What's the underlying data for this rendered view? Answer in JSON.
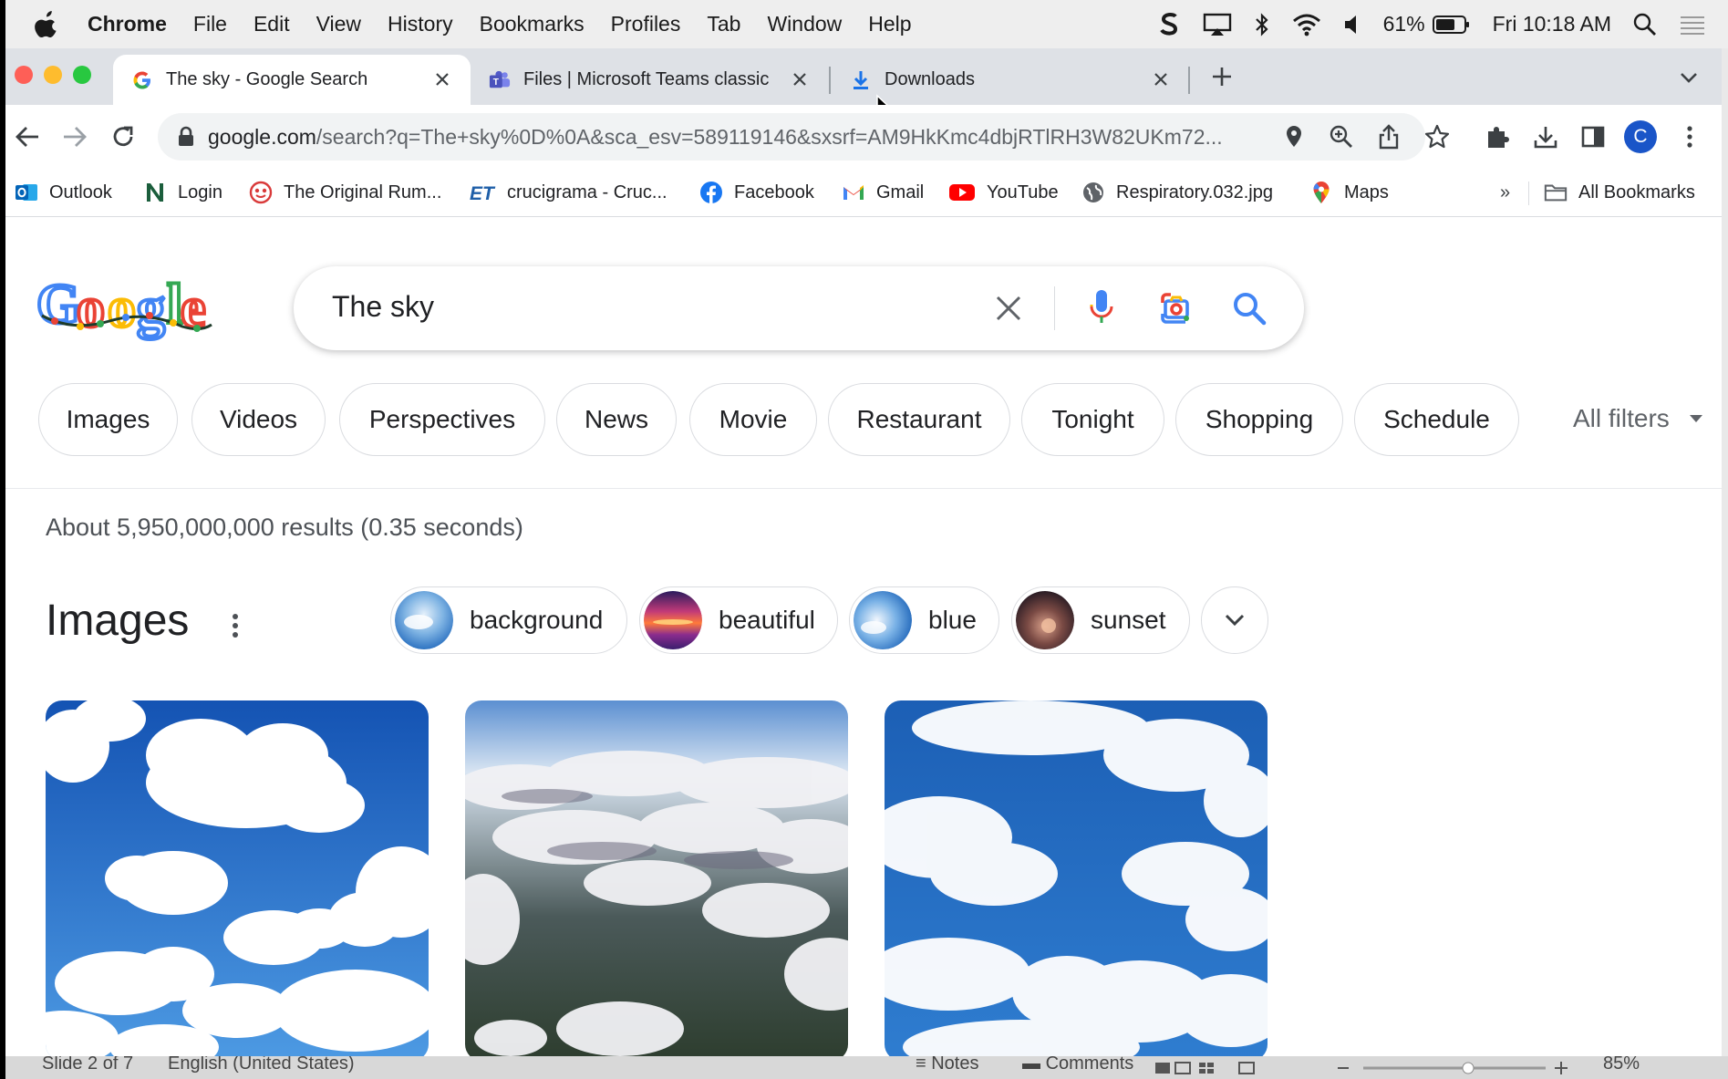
{
  "menubar": {
    "items": [
      "Chrome",
      "File",
      "Edit",
      "View",
      "History",
      "Bookmarks",
      "Profiles",
      "Tab",
      "Window",
      "Help"
    ],
    "battery": "61%",
    "clock": "Fri 10:18 AM"
  },
  "tabs": [
    {
      "title": "The sky - Google Search",
      "favicon": "google-g-icon"
    },
    {
      "title": "Files | Microsoft Teams classic",
      "favicon": "teams-icon"
    },
    {
      "title": "Downloads",
      "favicon": "download-icon"
    }
  ],
  "address": {
    "host": "google.com",
    "path": "/search?q=The+sky%0D%0A&sca_esv=589119146&sxsrf=AM9HkKmc4dbjRTlRH3W82UKm72..."
  },
  "bookmarks": [
    {
      "label": "Outlook"
    },
    {
      "label": "Login"
    },
    {
      "label": "The Original Rum..."
    },
    {
      "label": "crucigrama - Cruc..."
    },
    {
      "label": "Facebook"
    },
    {
      "label": "Gmail"
    },
    {
      "label": "YouTube"
    },
    {
      "label": "Respiratory.032.jpg"
    },
    {
      "label": "Maps"
    }
  ],
  "bookmarks_more": "»",
  "all_bookmarks": "All Bookmarks",
  "search": {
    "query": "The sky",
    "stats": "About 5,950,000,000 results (0.35 seconds)"
  },
  "chips": [
    "Images",
    "Videos",
    "Perspectives",
    "News",
    "Movie",
    "Restaurant",
    "Tonight",
    "Shopping",
    "Schedule"
  ],
  "all_filters": "All filters",
  "images_section": {
    "title": "Images",
    "refinements": [
      "background",
      "beautiful",
      "blue",
      "sunset"
    ]
  },
  "ppt_status": {
    "slide": "Slide 2 of 7",
    "language": "English (United States)",
    "notes": "Notes",
    "comments": "Comments",
    "zoom": "85%"
  },
  "colors": {
    "google_blue": "#4285f4",
    "google_red": "#ea4335",
    "google_yellow": "#fbbc05",
    "google_green": "#34a853",
    "chip_border": "#dadce0"
  }
}
